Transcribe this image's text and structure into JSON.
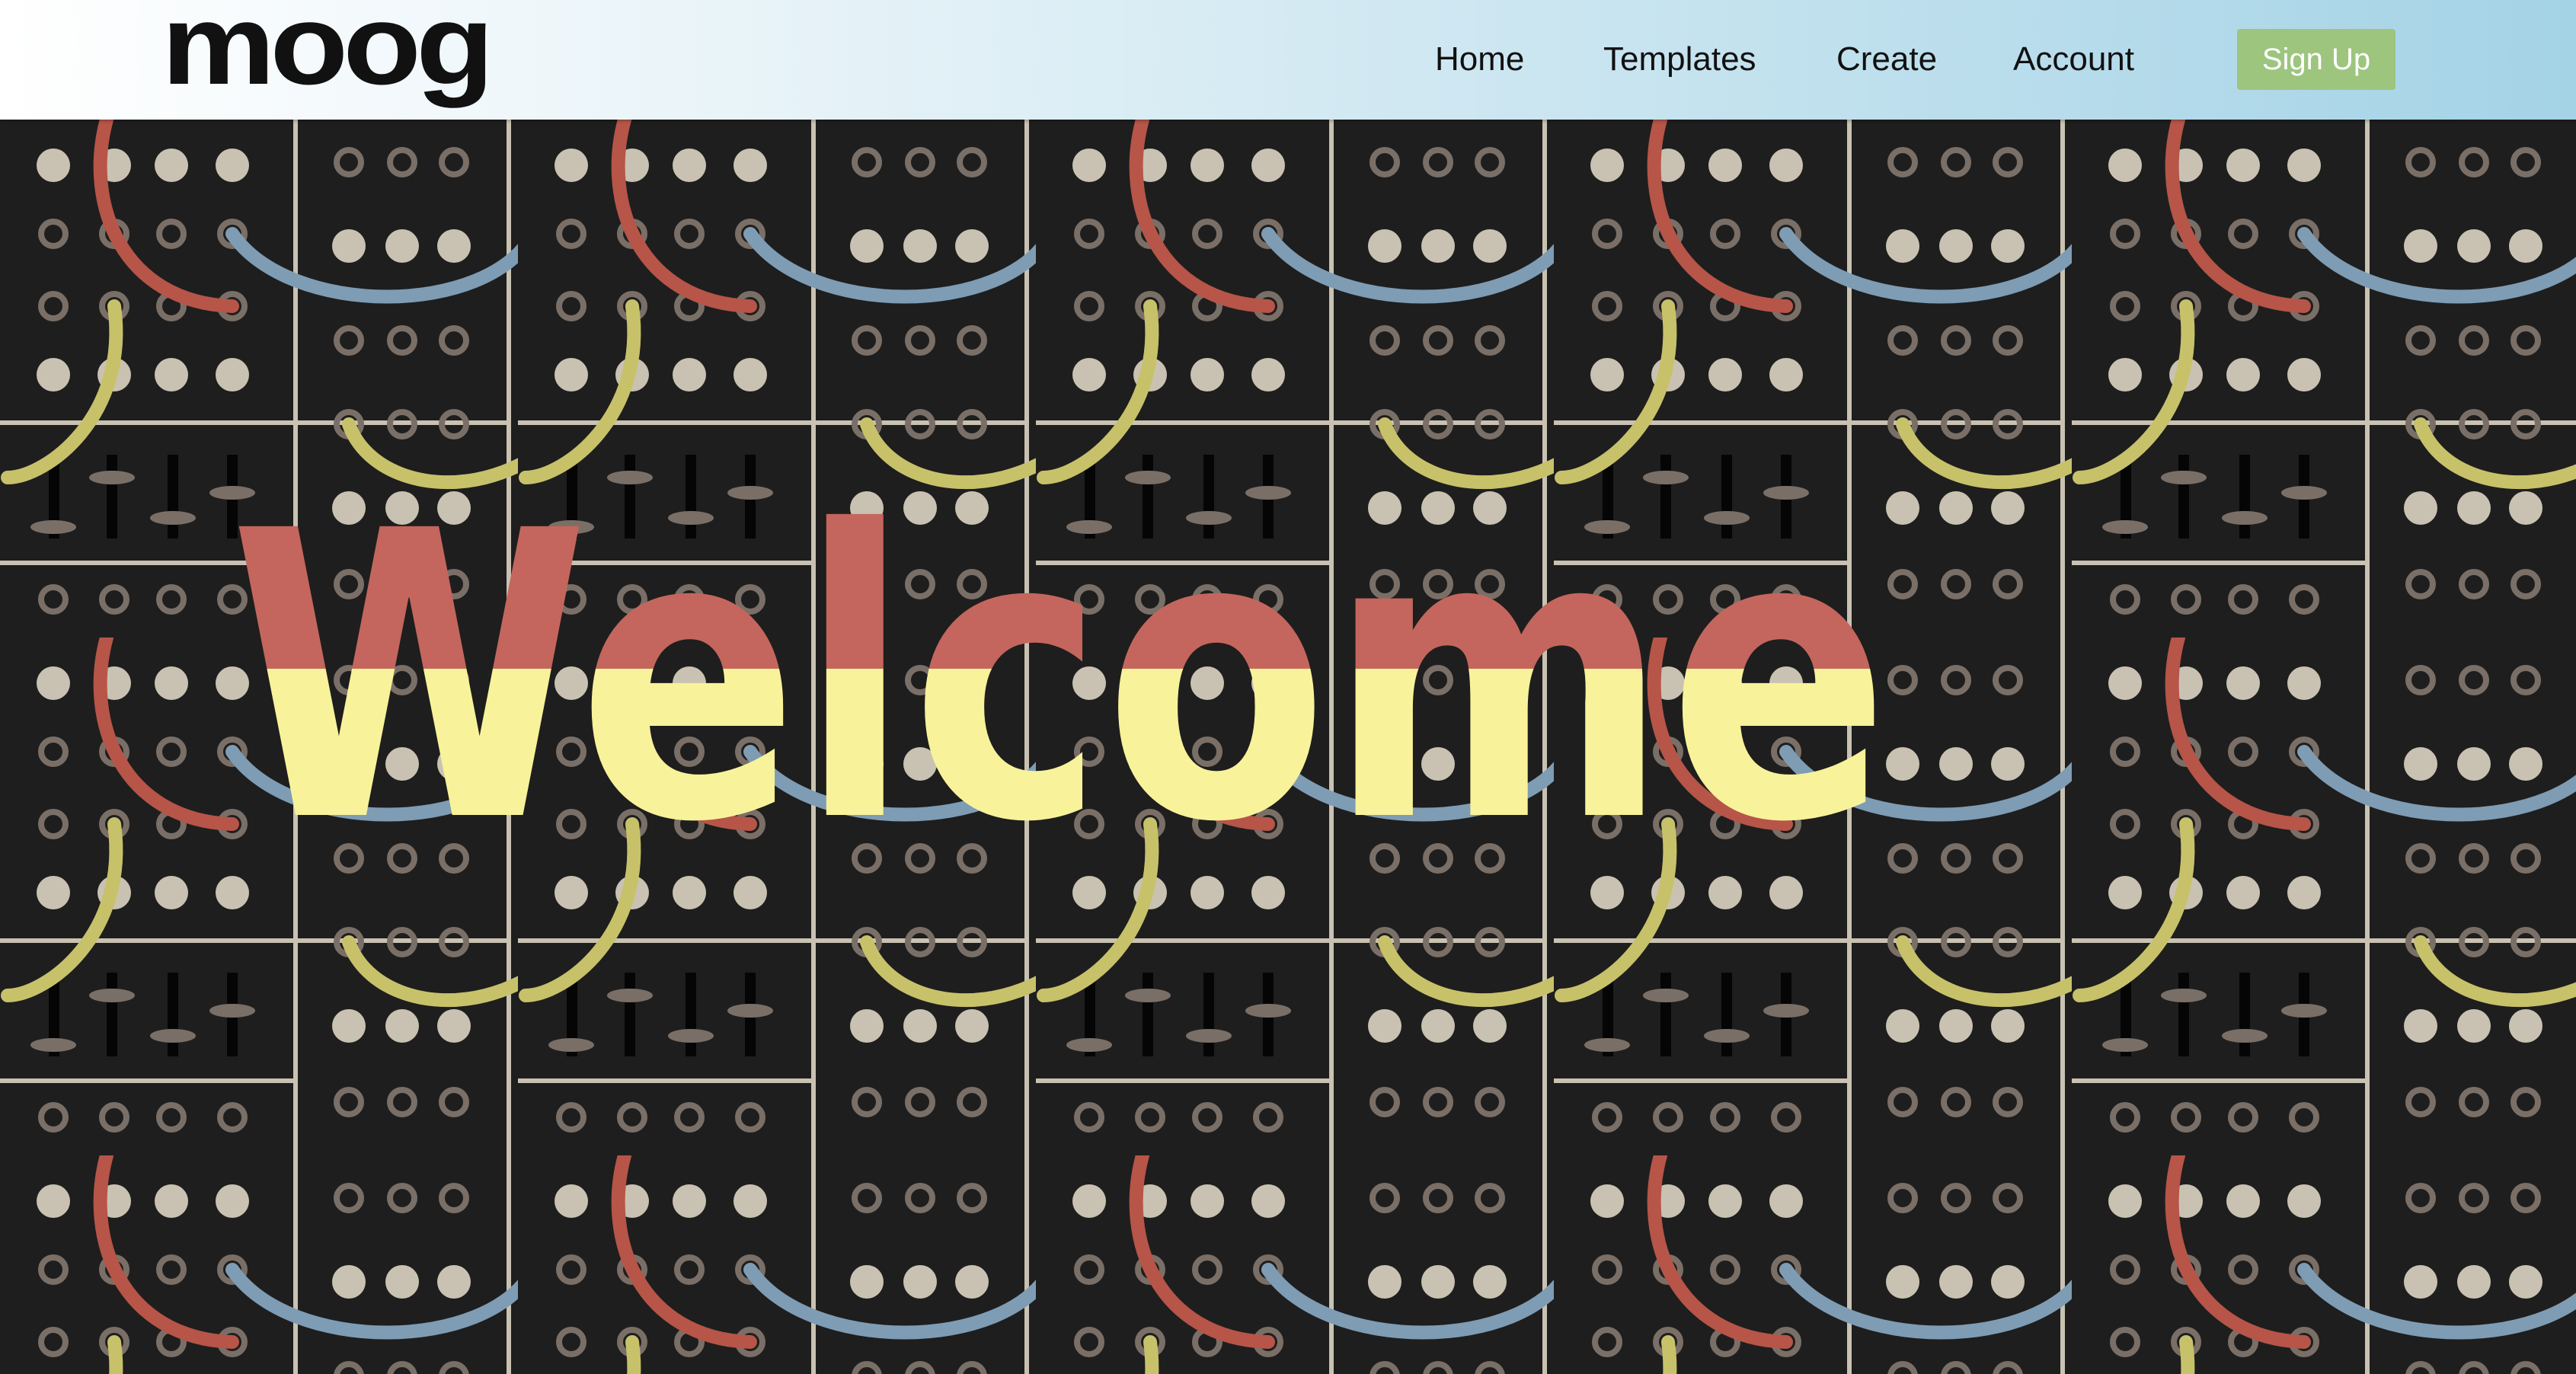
{
  "brand": {
    "logo_text": "moog"
  },
  "nav": {
    "links": [
      {
        "label": "Home"
      },
      {
        "label": "Templates"
      },
      {
        "label": "Create"
      },
      {
        "label": "Account"
      }
    ],
    "signup_label": "Sign Up"
  },
  "hero": {
    "heading": "Welcome"
  },
  "colors": {
    "panel": "#1e1e1e",
    "jack": "#c9c2b2",
    "cable_red": "#b65548",
    "cable_blue": "#7e9cb4",
    "cable_yellow": "#c7c16a",
    "welcome_top": "#c4665d",
    "welcome_bottom": "#f8f29a",
    "signup": "#9dc57e"
  }
}
